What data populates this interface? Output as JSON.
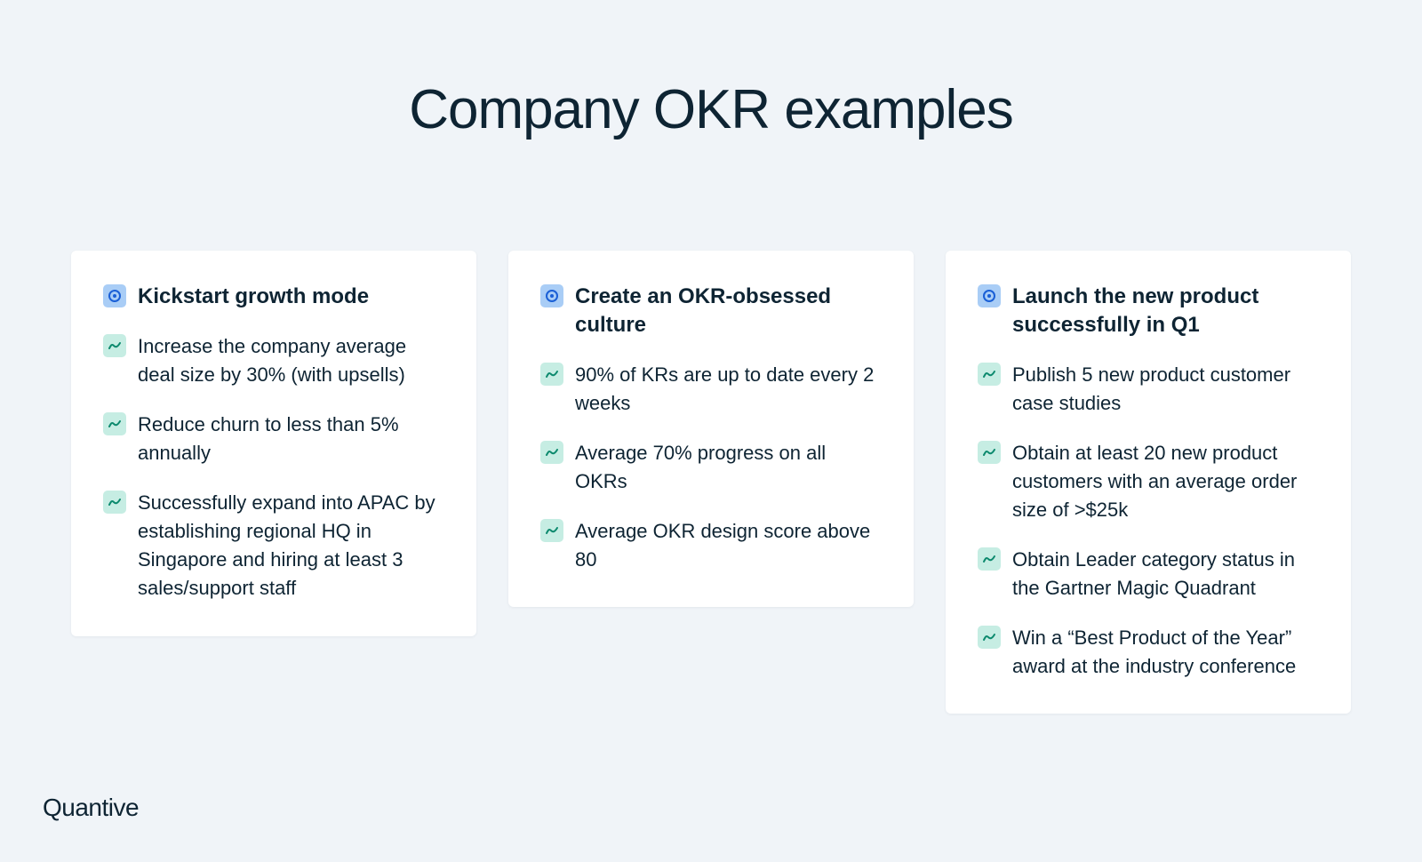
{
  "title": "Company OKR examples",
  "brand": "Quantive",
  "colors": {
    "background": "#f0f4f8",
    "card": "#ffffff",
    "text": "#0e2433",
    "objective_icon_bg": "#a9cdf6",
    "objective_icon_fg": "#1a5fd6",
    "kr_icon_bg": "#c6ede3",
    "kr_icon_fg": "#0d8a6e"
  },
  "icons": {
    "objective": "target-icon",
    "key_result": "trend-line-icon"
  },
  "cards": [
    {
      "objective": "Kickstart growth mode",
      "key_results": [
        "Increase the company average deal size by 30% (with upsells)",
        "Reduce churn to less than 5% annually",
        "Successfully expand into APAC by establishing regional HQ in Singapore and hiring at least 3 sales/support staff"
      ]
    },
    {
      "objective": "Create an OKR-obsessed culture",
      "key_results": [
        "90% of KRs are up to date every 2 weeks",
        "Average 70% progress on all OKRs",
        "Average OKR design score above 80"
      ]
    },
    {
      "objective": "Launch the new product successfully in Q1",
      "key_results": [
        "Publish 5 new product customer case studies",
        "Obtain at least 20 new product customers with an average order size of >$25k",
        "Obtain Leader category status in the Gartner Magic Quadrant",
        "Win a “Best Product of the Year” award at the industry conference"
      ]
    }
  ]
}
